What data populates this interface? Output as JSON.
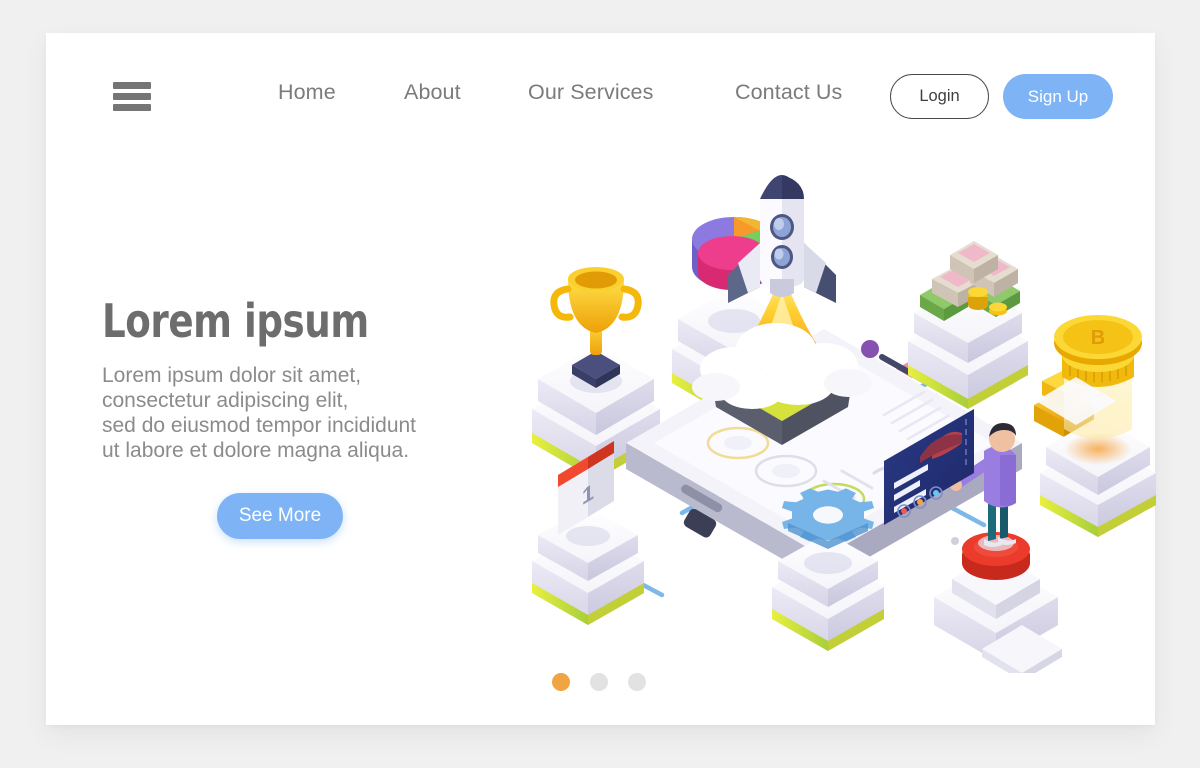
{
  "page": {
    "background_color": "#f0f0f0",
    "card_background": "#ffffff"
  },
  "nav": {
    "menu_icon": "hamburger-menu-icon",
    "links": [
      {
        "label": "Home"
      },
      {
        "label": "About"
      },
      {
        "label": "Our Services"
      },
      {
        "label": "Contact Us"
      }
    ],
    "login_label": "Login",
    "signup_label": "Sign Up",
    "link_color": "#7b7b7b",
    "signup_color": "#7eb4f5"
  },
  "hero": {
    "title": "Lorem ipsum",
    "subtitle": "Lorem ipsum dolor sit amet,\nconsectetur adipiscing elit,\nsed do eiusmod tempor incididunt\nut labore et dolore magna aliqua.",
    "cta_label": "See More",
    "title_color": "#6d6d6d",
    "subtitle_color": "#8b8b8b",
    "cta_color": "#7eb4f5"
  },
  "carousel": {
    "dots": [
      {
        "state": "active",
        "color": "#f0a542"
      },
      {
        "state": "inactive",
        "color": "#e2e2e2"
      },
      {
        "state": "inactive",
        "color": "#e2e2e2"
      }
    ]
  },
  "illustration": {
    "name": "isometric-startup-growth-illustration",
    "calendar_day": "1",
    "coin_symbol": "B",
    "palette": {
      "platform_top": "#ffffff",
      "platform_side": "#d7d7e6",
      "platform_stripe": "#d6e23c",
      "connector_line": "#7db8e8",
      "rocket_body": "#fdfdff",
      "rocket_accent": "#3f4570",
      "flame": "#ffc629",
      "gold": "#f5c316",
      "trophy": "#f5b808",
      "gear": "#77b4e8",
      "person_shirt": "#9a7de0",
      "person_pants": "#1b6b7a",
      "person_pad": "#ec3a2b",
      "screen": "#28367a",
      "calendar_top": "#ef4a30",
      "pie_purple": "#8d7ae0",
      "pie_orange": "#f89a2b",
      "pie_green": "#74cf5c",
      "pie_pink": "#ef3d8e",
      "gift_green": "#7cba58",
      "gift_cream": "#ded4c8"
    }
  }
}
